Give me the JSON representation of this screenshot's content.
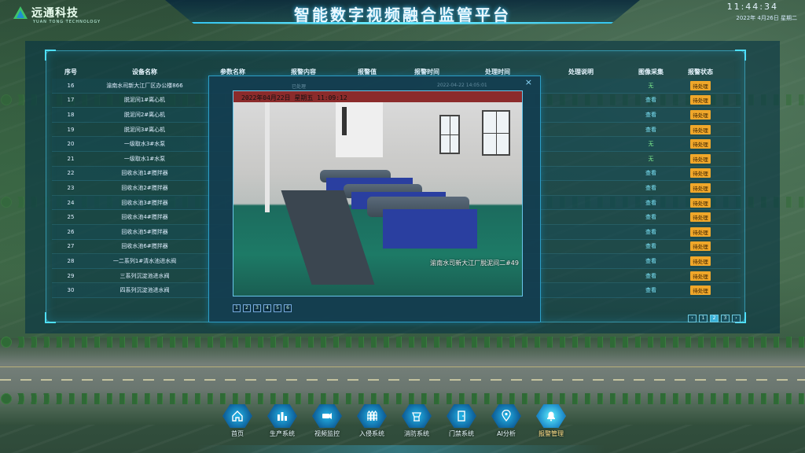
{
  "header": {
    "logo_text": "远通科技",
    "logo_sub": "YUAN TONG TECHNOLOGY",
    "title": "智能数字视频融合监管平台",
    "time": "11:44:34",
    "date": "2022年 4月26日 星期二"
  },
  "table": {
    "columns": [
      "序号",
      "设备名称",
      "参数名称",
      "报警内容",
      "报警值",
      "报警时间",
      "处理时间",
      "处理说明",
      "图像采集",
      "报警状态"
    ],
    "rows": [
      {
        "no": "16",
        "device": "渝南水司新大江厂区办公楼866",
        "image": "无",
        "status": "待处理"
      },
      {
        "no": "17",
        "device": "脱泥间1#离心机",
        "image": "查看",
        "status": "待处理"
      },
      {
        "no": "18",
        "device": "脱泥间2#离心机",
        "image": "查看",
        "status": "待处理"
      },
      {
        "no": "19",
        "device": "脱泥间3#离心机",
        "image": "查看",
        "status": "待处理"
      },
      {
        "no": "20",
        "device": "一级取水3#水泵",
        "image": "无",
        "status": "待处理"
      },
      {
        "no": "21",
        "device": "一级取水1#水泵",
        "image": "无",
        "status": "待处理"
      },
      {
        "no": "22",
        "device": "回收水池1#搅拌器",
        "image": "查看",
        "status": "待处理"
      },
      {
        "no": "23",
        "device": "回收水池2#搅拌器",
        "image": "查看",
        "status": "待处理"
      },
      {
        "no": "24",
        "device": "回收水池3#搅拌器",
        "image": "查看",
        "status": "待处理"
      },
      {
        "no": "25",
        "device": "回收水池4#搅拌器",
        "image": "查看",
        "status": "待处理"
      },
      {
        "no": "26",
        "device": "回收水池5#搅拌器",
        "image": "查看",
        "status": "待处理"
      },
      {
        "no": "27",
        "device": "回收水池6#搅拌器",
        "image": "查看",
        "status": "待处理"
      },
      {
        "no": "28",
        "device": "一二系列1#清水池进水阀",
        "image": "查看",
        "status": "待处理"
      },
      {
        "no": "29",
        "device": "三系列沉淀池进水阀",
        "image": "查看",
        "status": "待处理"
      },
      {
        "no": "30",
        "device": "四系列沉淀池进水阀",
        "image": "查看",
        "status": "待处理"
      }
    ],
    "pager": [
      "‹",
      "1",
      "2",
      "3",
      "›"
    ],
    "pager_active": "2"
  },
  "modal": {
    "header_left": "已处理",
    "header_time": "2022-04-22 14:05:01",
    "close_symbol": "×",
    "timestamp": "2022年04月22日 星期五 11:09:12",
    "caption": "渝南水司新大江厂脱泥间二#49",
    "channels": [
      "1",
      "2",
      "3",
      "4",
      "5",
      "6"
    ]
  },
  "nav": [
    {
      "label": "首页",
      "icon": "home-icon"
    },
    {
      "label": "生产系统",
      "icon": "production-icon"
    },
    {
      "label": "视频监控",
      "icon": "camera-icon"
    },
    {
      "label": "入侵系统",
      "icon": "fence-icon"
    },
    {
      "label": "消防系统",
      "icon": "fire-icon"
    },
    {
      "label": "门禁系统",
      "icon": "door-icon"
    },
    {
      "label": "AI分析",
      "icon": "location-icon"
    },
    {
      "label": "报警管理",
      "icon": "alarm-icon",
      "active": true
    }
  ],
  "colors": {
    "accent": "#37c6f0",
    "badge": "#f0a72a",
    "link": "#7fe9ff",
    "none": "#7ff08f"
  }
}
